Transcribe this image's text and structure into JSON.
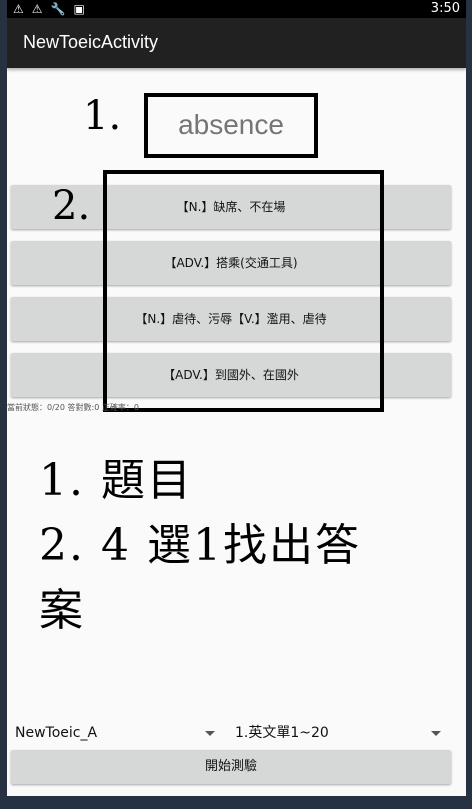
{
  "status_bar": {
    "time": "3:50",
    "icons": [
      "warning-icon",
      "warning-icon",
      "wrench-icon",
      "sim-card-icon"
    ]
  },
  "app_bar": {
    "title": "NewToeicActivity"
  },
  "annotations": {
    "label_1": "1.",
    "label_2": "2.",
    "instructions_line1": "1. 題目",
    "instructions_line2": "2. 4 選1找出答",
    "instructions_line3": "案"
  },
  "question": {
    "word": "absence"
  },
  "options": [
    "【N.】缺席、不在場",
    "【ADV.】搭乘(交通工具)",
    "【N.】虐待、污辱【V.】濫用、虐待",
    "【ADV.】到國外、在國外"
  ],
  "status": "當前狀態：0/20 答對數:0 正確率：0",
  "controls": {
    "spinner_set": "NewToeic_A",
    "spinner_unit": "1.英文單1~20",
    "start_label": "開始測驗"
  }
}
